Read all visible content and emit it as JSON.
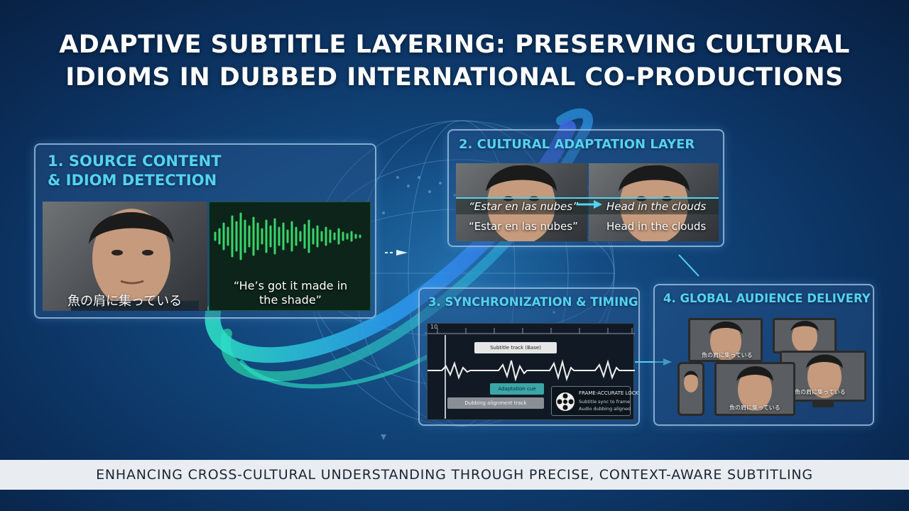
{
  "title": {
    "line1": "ADAPTIVE SUBTITLE LAYERING: PRESERVING CULTURAL",
    "line2": "IDIOMS IN DUBBED INTERNATIONAL CO-PRODUCTIONS"
  },
  "panel1": {
    "title_line1": "1. SOURCE CONTENT",
    "title_line2": "& IDIOM DETECTION",
    "japanese_subtitle": "魚の肩に集っている",
    "waveform_caption_line1": "“He’s got it made in",
    "waveform_caption_line2": "the shade”"
  },
  "panel2": {
    "title": "2. CULTURAL ADAPTATION LAYER",
    "idiom_source_italic": "“Estar en las nubes”",
    "idiom_target_italic": "Head in the clouds",
    "idiom_source": "“Estar en las nubes”",
    "idiom_target": "Head in the clouds"
  },
  "panel3": {
    "title": "3. SYNCHRONIZATION & TIMING",
    "ruler_label": "10",
    "cue1": "Subtitle track (Base)",
    "cue2": "Adaptation cue",
    "cue3": "Dubbing alignment track",
    "frame_lock_title": "FRAME-ACCURATE LOCK",
    "frame_lock_line1": "Subtitle sync to frame",
    "frame_lock_line2": "Audio dubbing aligned"
  },
  "panel4": {
    "title": "4. GLOBAL AUDIENCE DELIVERY",
    "tv_subtitle": "魚の肩に集っている",
    "monitor_subtitle": "魚の肩に集っている",
    "tablet_subtitle": "魚の肩に集っている"
  },
  "footer": {
    "text": "ENHANCING CROSS-CULTURAL UNDERSTANDING THROUGH PRECISE, CONTEXT-AWARE SUBTITLING"
  },
  "colors": {
    "accent_cyan": "#53d3f2",
    "waveform_green": "#39d46a",
    "background_dark": "#0b2f5c",
    "footer_bg": "#e9edf1"
  }
}
